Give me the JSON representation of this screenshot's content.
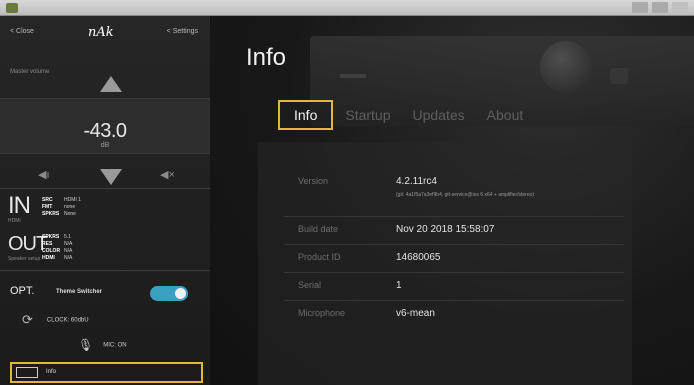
{
  "titlebar": {
    "title": ""
  },
  "sidebar": {
    "back_label": "< Close",
    "logo": "nAk",
    "right_label": "< Settings",
    "volume_label": "Master volume",
    "volume_value": "-43.0",
    "volume_unit": "dB",
    "input": {
      "big": "IN",
      "sub": "HDMI",
      "rows": [
        {
          "k": "SRC",
          "v": "HDMI 1"
        },
        {
          "k": "FMT",
          "v": "none"
        },
        {
          "k": "SPKRS",
          "v": "None"
        }
      ]
    },
    "output": {
      "big": "OUT",
      "sub": "Speaker setup",
      "rows": [
        {
          "k": "SPKRS",
          "v": "5.1"
        },
        {
          "k": "RES",
          "v": "N/A"
        },
        {
          "k": "COLOR",
          "v": "N/A"
        },
        {
          "k": "HDMI",
          "v": "N/A"
        }
      ]
    },
    "opt": {
      "big": "OPT.",
      "label": "Theme Switcher",
      "toggle_on": true
    },
    "clock": {
      "label": "CLOCK: 60dbU"
    },
    "mic": {
      "label": "MIC: ON"
    },
    "info": {
      "label": "Info"
    }
  },
  "main": {
    "title": "Info",
    "tabs": [
      {
        "label": "Info",
        "active": true
      },
      {
        "label": "Startup",
        "active": false
      },
      {
        "label": "Updates",
        "active": false
      },
      {
        "label": "About",
        "active": false
      }
    ],
    "fields": [
      {
        "key": "Version",
        "value": "4.2.11rc4",
        "note": "(git: 4a1f5a7a3ef9b4, git-service@ios 6 x64 + amplifier/stereo)"
      },
      {
        "key": "Build date",
        "value": "Nov 20 2018 15:58:07"
      },
      {
        "key": "Product ID",
        "value": "14680065"
      },
      {
        "key": "Serial",
        "value": "1"
      },
      {
        "key": "Microphone",
        "value": "v6-mean"
      }
    ]
  },
  "colors": {
    "highlight": "#e0b83a",
    "toggle": "#3aa0c0"
  }
}
